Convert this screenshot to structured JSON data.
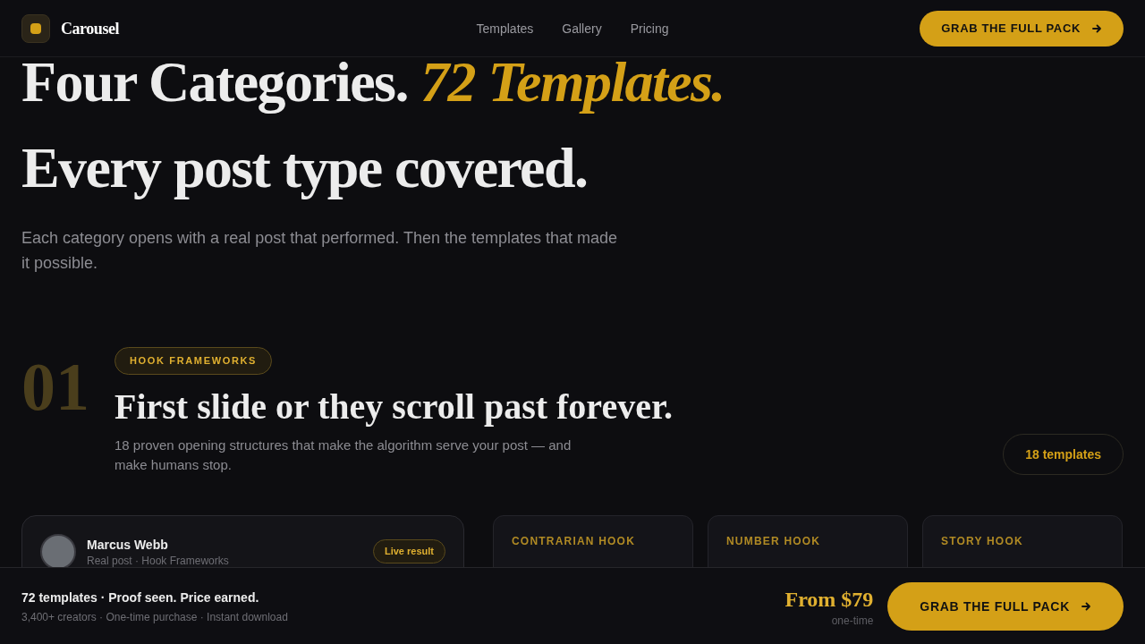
{
  "header": {
    "brand": "Carousel",
    "nav": [
      {
        "label": "Templates"
      },
      {
        "label": "Gallery"
      },
      {
        "label": "Pricing"
      }
    ],
    "cta": "GRAB THE FULL PACK"
  },
  "hero": {
    "title": "Four Categories.",
    "title_accent": "72 Templates.",
    "subtitle": "Every post type covered.",
    "lead": "Each category opens with a real post that performed. Then the templates that made it possible."
  },
  "category": {
    "number": "01",
    "tag": "HOOK FRAMEWORKS",
    "title": "First slide or they scroll past forever.",
    "description": "18 proven opening structures that make the algorithm serve your post — and make humans stop.",
    "count": "18 templates"
  },
  "post": {
    "author": "Marcus Webb",
    "meta": "Real post · Hook Frameworks",
    "badge": "Live result"
  },
  "templates": [
    {
      "label": "CONTRARIAN HOOK"
    },
    {
      "label": "NUMBER HOOK"
    },
    {
      "label": "STORY HOOK"
    }
  ],
  "footer": {
    "headline": "72 templates · Proof seen. Price earned.",
    "meta": "3,400+ creators · One-time purchase · Instant download",
    "price": "From $79",
    "price_note": "one-time",
    "cta": "GRAB THE FULL PACK"
  }
}
